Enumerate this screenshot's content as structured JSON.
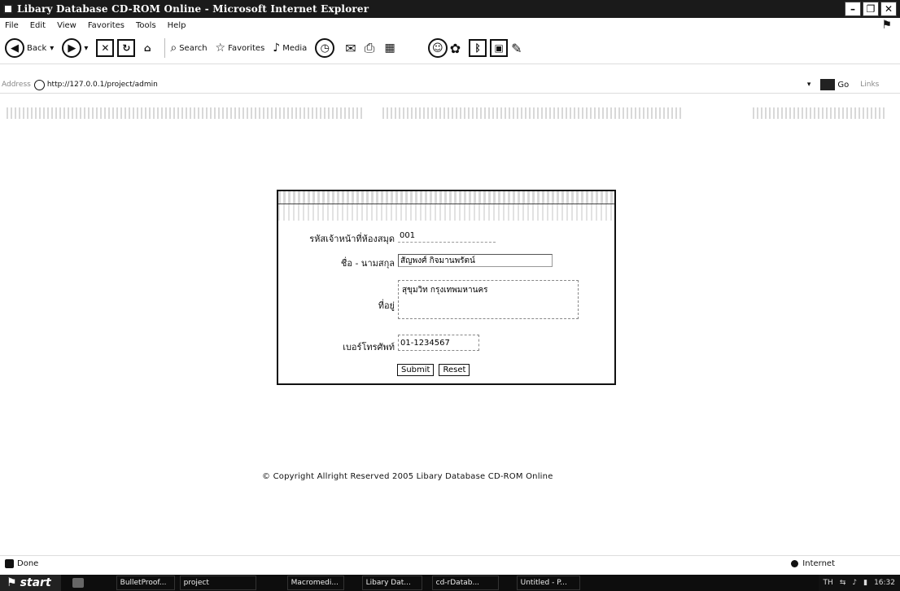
{
  "window": {
    "title": "Libary Database CD-ROM Online - Microsoft Internet Explorer"
  },
  "menu": [
    "File",
    "Edit",
    "View",
    "Favorites",
    "Tools",
    "Help"
  ],
  "toolbar": {
    "back": "Back",
    "search": "Search",
    "favorites": "Favorites",
    "media": "Media"
  },
  "address": {
    "label": "Address",
    "url": "http://127.0.0.1/project/admin",
    "go": "Go",
    "links": "Links"
  },
  "form": {
    "id_label": "รหัสเจ้าหน้าที่ห้องสมุด",
    "id_value": "001",
    "name_label": "ชื่อ - นามสกุล",
    "name_value": "สัญพงศ์ กิจมานพรัตน์",
    "address_label": "ที่อยู่",
    "address_value": "สุขุมวิท กรุงเทพมหานคร",
    "phone_label": "เบอร์โทรศัพท์",
    "phone_value": "01-1234567",
    "submit": "Submit",
    "reset": "Reset"
  },
  "footer": {
    "copyright": "© Copyright Allright Reserved 2005 Libary Database CD-ROM Online"
  },
  "status": {
    "text": "Done",
    "zone": "Internet"
  },
  "taskbar": {
    "start": "start",
    "tasks": [
      "BulletProof...",
      "project",
      "Macromedi...",
      "Libary Dat...",
      "cd-rDatab...",
      "Untitled - P..."
    ],
    "lang": "TH",
    "clock": "16:32"
  }
}
